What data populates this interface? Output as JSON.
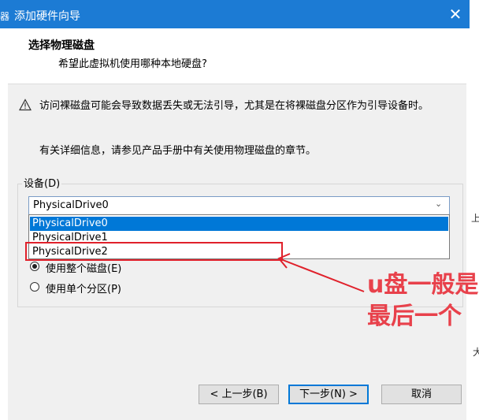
{
  "window": {
    "title": "添加硬件向导",
    "close_glyph": "✕",
    "left_stub": "器"
  },
  "header": {
    "title": "选择物理磁盘",
    "subtitle": "希望此虚拟机使用哪种本地硬盘?"
  },
  "warning": {
    "text": "访问裸磁盘可能会导致数据丢失或无法引导，尤其是在将裸磁盘分区作为引导设备时。",
    "icon": "warning-triangle-icon"
  },
  "info_text": "有关详细信息，请参见产品手册中有关使用物理磁盘的章节。",
  "device_group": {
    "label": "设备(D)",
    "selected": "PhysicalDrive0",
    "options": [
      "PhysicalDrive0",
      "PhysicalDrive1",
      "PhysicalDrive2"
    ],
    "highlighted_index": 0
  },
  "usage": {
    "options": [
      {
        "label": "使用整个磁盘(E)",
        "checked": true
      },
      {
        "label": "使用单个分区(P)",
        "checked": false
      }
    ]
  },
  "annotation": {
    "line1": "u盘一般是",
    "line2": "最后一个",
    "color": "#e8414b"
  },
  "buttons": {
    "back": "< 上一步(B)",
    "next": "下一步(N) >",
    "cancel": "取消"
  },
  "edge_texts": {
    "right1": "上",
    "right2": "大"
  },
  "colors": {
    "titlebar": "#1c7bd4",
    "selection": "#0078d7",
    "annotation_red": "#e0212b"
  }
}
